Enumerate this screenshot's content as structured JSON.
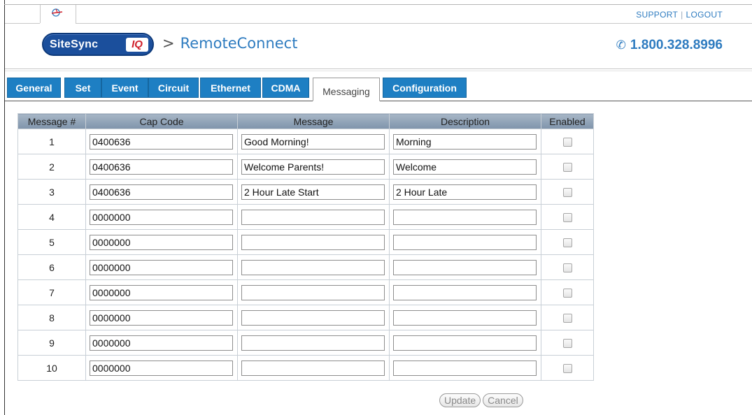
{
  "browser": {
    "tab_icon": "site-favicon"
  },
  "top_links": {
    "support": "SUPPORT",
    "separator": "|",
    "logout": "LOGOUT"
  },
  "header": {
    "logo_text": "SiteSync",
    "logo_badge": "IQ",
    "breadcrumb_sep": ">",
    "app_title": "RemoteConnect",
    "phone_icon": "phone-icon",
    "phone": "1.800.328.8996"
  },
  "tabs": [
    {
      "label": "General"
    },
    {
      "label": "Set"
    },
    {
      "label": "Event"
    },
    {
      "label": "Circuit"
    },
    {
      "label": "Ethernet"
    },
    {
      "label": "CDMA"
    },
    {
      "label": "Messaging",
      "active": true
    },
    {
      "label": "Configuration"
    }
  ],
  "table": {
    "headers": [
      "Message #",
      "Cap Code",
      "Message",
      "Description",
      "Enabled"
    ],
    "rows": [
      {
        "num": "1",
        "cap_code": "0400636",
        "message": "Good Morning!",
        "description": "Morning",
        "enabled": false
      },
      {
        "num": "2",
        "cap_code": "0400636",
        "message": "Welcome Parents!",
        "description": "Welcome",
        "enabled": false
      },
      {
        "num": "3",
        "cap_code": "0400636",
        "message": "2 Hour Late Start",
        "description": "2 Hour Late",
        "enabled": false
      },
      {
        "num": "4",
        "cap_code": "0000000",
        "message": "",
        "description": "",
        "enabled": false
      },
      {
        "num": "5",
        "cap_code": "0000000",
        "message": "",
        "description": "",
        "enabled": false
      },
      {
        "num": "6",
        "cap_code": "0000000",
        "message": "",
        "description": "",
        "enabled": false
      },
      {
        "num": "7",
        "cap_code": "0000000",
        "message": "",
        "description": "",
        "enabled": false
      },
      {
        "num": "8",
        "cap_code": "0000000",
        "message": "",
        "description": "",
        "enabled": false
      },
      {
        "num": "9",
        "cap_code": "0000000",
        "message": "",
        "description": "",
        "enabled": false
      },
      {
        "num": "10",
        "cap_code": "0000000",
        "message": "",
        "description": "",
        "enabled": false
      }
    ]
  },
  "actions": {
    "update": "Update",
    "cancel": "Cancel"
  },
  "colors": {
    "brand_blue": "#1e7fc3",
    "link_blue": "#2f7cc0",
    "logo_navy": "#1b4f9c",
    "logo_red": "#d0202b"
  }
}
